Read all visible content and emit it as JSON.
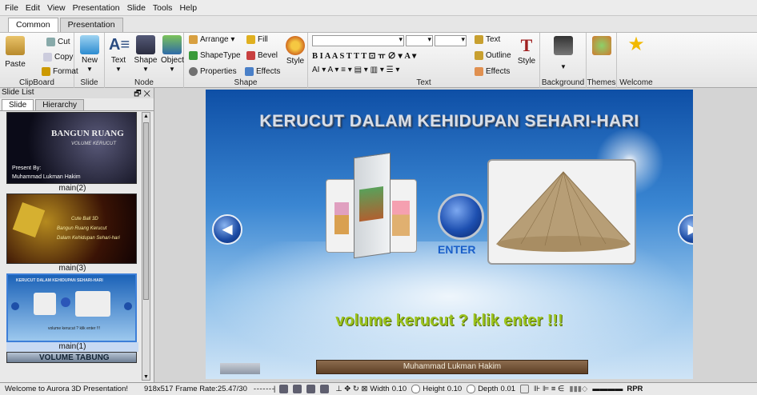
{
  "menu": [
    "File",
    "Edit",
    "View",
    "Presentation",
    "Slide",
    "Tools",
    "Help"
  ],
  "ribbon_tabs": [
    {
      "label": "Common",
      "active": true
    },
    {
      "label": "Presentation",
      "active": false
    }
  ],
  "clipboard": {
    "paste": "Paste",
    "cut": "Cut",
    "copy": "Copy",
    "format": "Format",
    "group": "ClipBoard"
  },
  "slide_grp": {
    "new": "New",
    "group": "Slide"
  },
  "node": {
    "text": "Text",
    "shape": "Shape",
    "object": "Object",
    "group": "Node"
  },
  "shape_grp": {
    "arrange": "Arrange",
    "fill": "Fill",
    "shapetype": "ShapeType",
    "bevel": "Bevel",
    "properties": "Properties",
    "effects": "Effects",
    "style": "Style",
    "group": "Shape"
  },
  "text_grp": {
    "format_row": "B  I  A  A  S  T  T  T  ⊡  ㅠ  ∅ ▾ A ▾",
    "row3": "AI ▾ A ▾ ≡ ▾ ▤ ▾ ▥ ▾ ☰ ▾",
    "text": "Text",
    "outline": "Outline",
    "effects": "Effects",
    "style": "Style",
    "group": "Text"
  },
  "right_grp": {
    "background": "Background",
    "themes": "Themes",
    "welcome": "Welcome"
  },
  "panel": {
    "title": "Slide List",
    "close": "🗗 ✕",
    "tabs": [
      "Slide",
      "Hierarchy"
    ]
  },
  "thumbs": [
    {
      "caption": "main(2)",
      "t1": "BANGUN RUANG",
      "t2": "VOLUME KERUCUT",
      "t3": "Present By:",
      "t4": "Muhammad Lukman Hakim"
    },
    {
      "caption": "main(3)",
      "t1": "Cute Ball 3D",
      "t2": "Bangun Ruang Kerucut",
      "t3": "Dalam Kehidupan Sehari-hari"
    },
    {
      "caption": "main(1)",
      "t1": "KERUCUT DALAM KEHIDUPAN SEHARI-HARI",
      "t2": "volume kerucut ? klik enter !!!"
    },
    {
      "caption": "",
      "t1": "VOLUME TABUNG"
    }
  ],
  "slide": {
    "title": "KERUCUT DALAM KEHIDUPAN SEHARI-HARI",
    "enter": "ENTER",
    "prompt": "volume kerucut ? klik enter !!!",
    "author": "Muhammad Lukman Hakim"
  },
  "status": {
    "welcome": "Welcome to Aurora 3D Presentation!",
    "info": "918x517 Frame Rate:25.47/30",
    "width_label": "Width",
    "width_val": "0.10",
    "height_label": "Height",
    "height_val": "0.10",
    "depth_label": "Depth",
    "depth_val": "0.01",
    "tail": "RPR"
  }
}
